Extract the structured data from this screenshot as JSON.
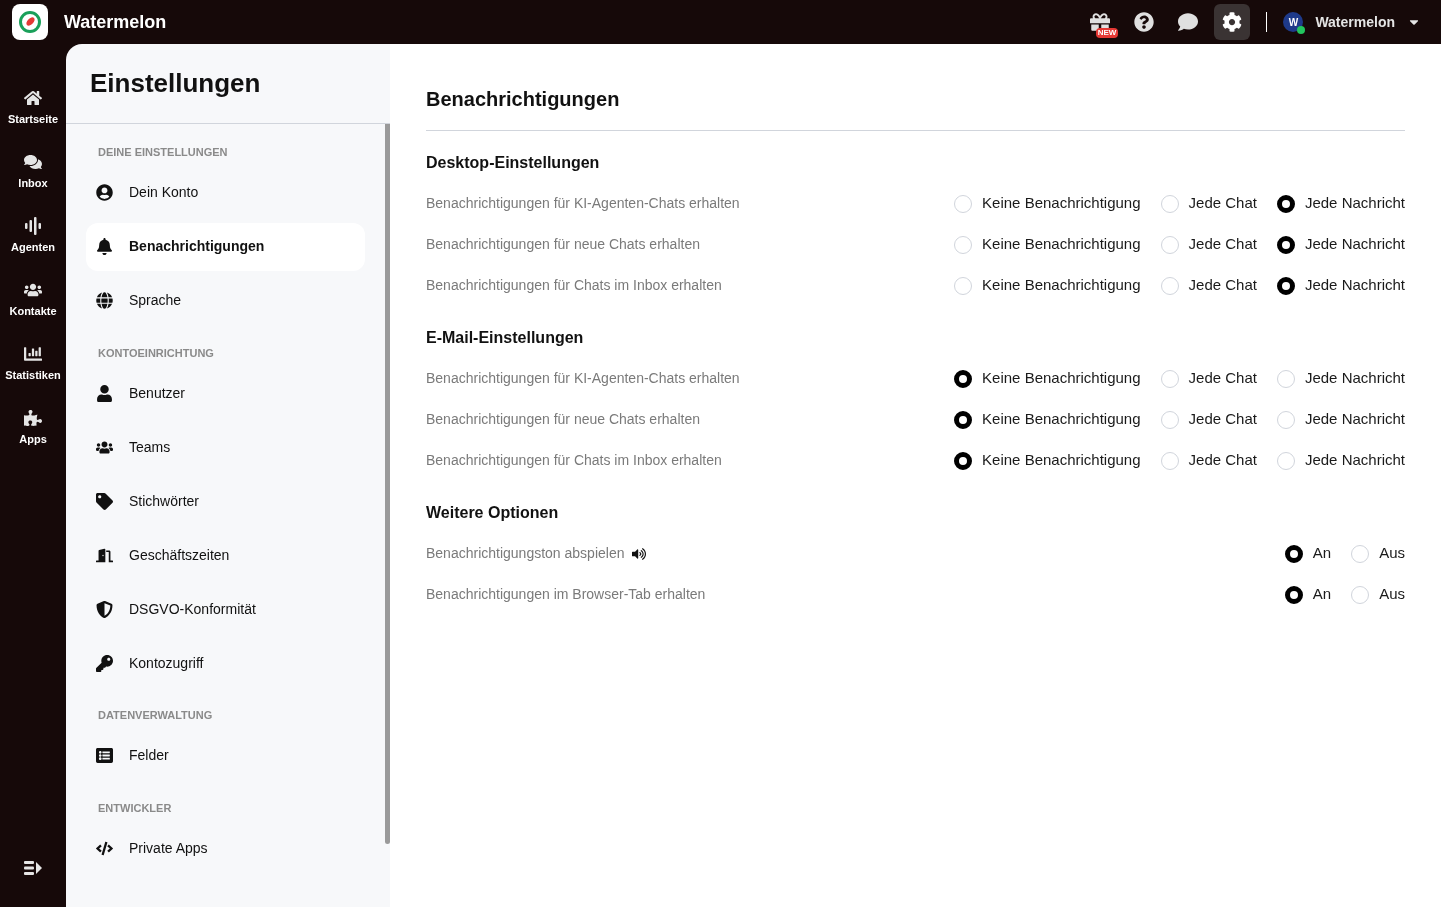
{
  "app_name": "Watermelon",
  "topbar": {
    "icons": [
      {
        "kind": "gift",
        "badge": "NEW",
        "selected": false
      },
      {
        "kind": "help",
        "selected": false
      },
      {
        "kind": "chat",
        "selected": false
      },
      {
        "kind": "settings",
        "selected": true
      }
    ],
    "user": {
      "initial": "W",
      "name": "Watermelon",
      "online": true
    }
  },
  "nav": [
    {
      "kind": "home",
      "label": "Startseite",
      "selected": false
    },
    {
      "kind": "inbox",
      "label": "Inbox",
      "selected": false
    },
    {
      "kind": "agents",
      "label": "Agenten",
      "selected": false
    },
    {
      "kind": "contacts",
      "label": "Kontakte",
      "selected": false
    },
    {
      "kind": "stats",
      "label": "Statistiken",
      "selected": false
    },
    {
      "kind": "apps",
      "label": "Apps",
      "selected": false
    }
  ],
  "settings_sidebar": {
    "title": "Einstellungen",
    "sections": [
      {
        "heading": "DEINE EINSTELLUNGEN",
        "items": [
          {
            "kind": "account",
            "label": "Dein Konto",
            "selected": false
          },
          {
            "kind": "notifications",
            "label": "Benachrichtigungen",
            "selected": true
          },
          {
            "kind": "language",
            "label": "Sprache",
            "selected": false
          }
        ]
      },
      {
        "heading": "KONTOEINRICHTUNG",
        "items": [
          {
            "kind": "user",
            "label": "Benutzer",
            "selected": false
          },
          {
            "kind": "teams",
            "label": "Teams",
            "selected": false
          },
          {
            "kind": "tags",
            "label": "Stichwörter",
            "selected": false
          },
          {
            "kind": "hours",
            "label": "Geschäftszeiten",
            "selected": false
          },
          {
            "kind": "gdpr",
            "label": "DSGVO-Konformität",
            "selected": false
          },
          {
            "kind": "access",
            "label": "Kontozugriff",
            "selected": false
          }
        ]
      },
      {
        "heading": "DATENVERWALTUNG",
        "items": [
          {
            "kind": "fields",
            "label": "Felder",
            "selected": false
          }
        ]
      },
      {
        "heading": "ENTWICKLER",
        "items": [
          {
            "kind": "private_apps",
            "label": "Private Apps",
            "selected": false
          }
        ]
      }
    ]
  },
  "main": {
    "title": "Benachrichtigungen",
    "sections": [
      {
        "heading": "Desktop-Einstellungen",
        "rows": [
          {
            "kind": "plain",
            "label": "Benachrichtigungen für KI-Agenten-Chats erhalten",
            "options": [
              {
                "label": "Keine Benachrichtigung",
                "selected": false
              },
              {
                "label": "Jede Chat",
                "selected": false
              },
              {
                "label": "Jede Nachricht",
                "selected": true
              }
            ]
          },
          {
            "kind": "plain",
            "label": "Benachrichtigungen für neue Chats erhalten",
            "options": [
              {
                "label": "Keine Benachrichtigung",
                "selected": false
              },
              {
                "label": "Jede Chat",
                "selected": false
              },
              {
                "label": "Jede Nachricht",
                "selected": true
              }
            ]
          },
          {
            "kind": "plain",
            "label": "Benachrichtigungen für Chats im Inbox erhalten",
            "options": [
              {
                "label": "Keine Benachrichtigung",
                "selected": false
              },
              {
                "label": "Jede Chat",
                "selected": false
              },
              {
                "label": "Jede Nachricht",
                "selected": true
              }
            ]
          }
        ]
      },
      {
        "heading": "E-Mail-Einstellungen",
        "rows": [
          {
            "kind": "plain",
            "label": "Benachrichtigungen für KI-Agenten-Chats erhalten",
            "options": [
              {
                "label": "Keine Benachrichtigung",
                "selected": true
              },
              {
                "label": "Jede Chat",
                "selected": false
              },
              {
                "label": "Jede Nachricht",
                "selected": false
              }
            ]
          },
          {
            "kind": "plain",
            "label": "Benachrichtigungen für neue Chats erhalten",
            "options": [
              {
                "label": "Keine Benachrichtigung",
                "selected": true
              },
              {
                "label": "Jede Chat",
                "selected": false
              },
              {
                "label": "Jede Nachricht",
                "selected": false
              }
            ]
          },
          {
            "kind": "plain",
            "label": "Benachrichtigungen für Chats im Inbox erhalten",
            "options": [
              {
                "label": "Keine Benachrichtigung",
                "selected": true
              },
              {
                "label": "Jede Chat",
                "selected": false
              },
              {
                "label": "Jede Nachricht",
                "selected": false
              }
            ]
          }
        ]
      },
      {
        "heading": "Weitere Optionen",
        "rows": [
          {
            "kind": "sound",
            "label": "Benachrichtigungston abspielen",
            "options": [
              {
                "label": "An",
                "selected": true
              },
              {
                "label": "Aus",
                "selected": false
              }
            ]
          },
          {
            "kind": "plain",
            "label": "Benachrichtigungen im Browser-Tab erhalten",
            "options": [
              {
                "label": "An",
                "selected": true
              },
              {
                "label": "Aus",
                "selected": false
              }
            ]
          }
        ]
      }
    ]
  }
}
